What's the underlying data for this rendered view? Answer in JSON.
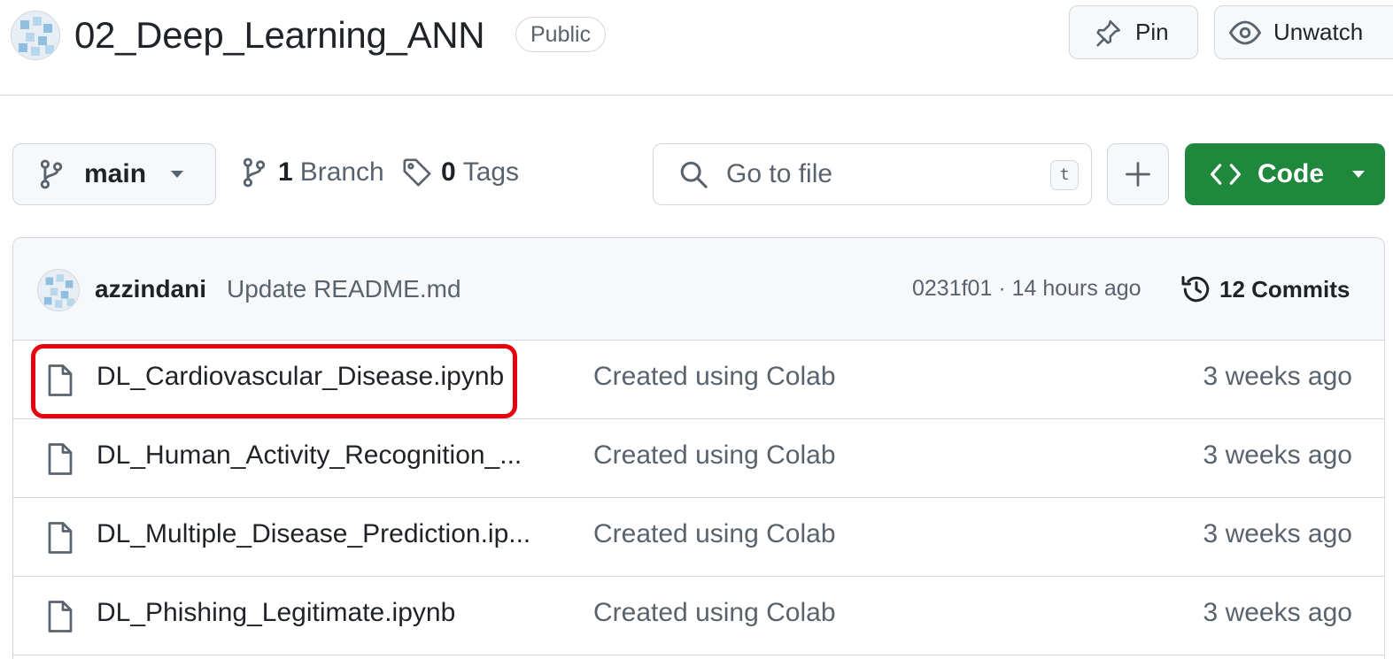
{
  "repo": {
    "name": "02_Deep_Learning_ANN",
    "visibility": "Public",
    "pin_label": "Pin",
    "unwatch_label": "Unwatch"
  },
  "toolbar": {
    "branch": "main",
    "branches_count": "1",
    "branches_label": "Branch",
    "tags_count": "0",
    "tags_label": "Tags",
    "search_placeholder": "Go to file",
    "search_shortcut": "t",
    "code_label": "Code"
  },
  "latest_commit": {
    "author": "azzindani",
    "message": "Update README.md",
    "sha_time": "0231f01 · 14 hours ago",
    "commits_label": "12 Commits"
  },
  "files": [
    {
      "name": "DL_Cardiovascular_Disease.ipynb",
      "message": "Created using Colab",
      "date": "3 weeks ago",
      "highlighted": true
    },
    {
      "name": "DL_Human_Activity_Recognition_...",
      "message": "Created using Colab",
      "date": "3 weeks ago"
    },
    {
      "name": "DL_Multiple_Disease_Prediction.ip...",
      "message": "Created using Colab",
      "date": "3 weeks ago"
    },
    {
      "name": "DL_Phishing_Legitimate.ipynb",
      "message": "Created using Colab",
      "date": "3 weeks ago"
    }
  ],
  "colors": {
    "accent_green": "#1f883d",
    "highlight_red": "#e8000d",
    "muted_text": "#59636e",
    "border": "#d0d7de"
  }
}
